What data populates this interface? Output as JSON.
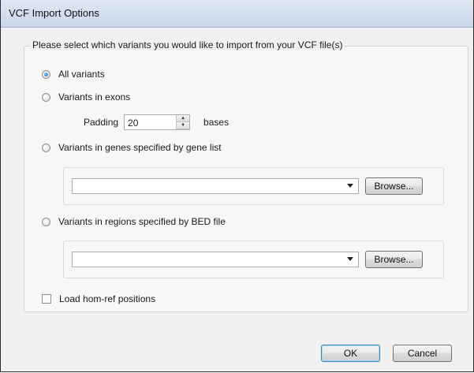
{
  "window": {
    "title": "VCF Import Options"
  },
  "group": {
    "label": "Please select which variants you would like to import from your VCF file(s)"
  },
  "options": {
    "all_variants": {
      "label": "All variants",
      "checked": true
    },
    "exons": {
      "label": "Variants in exons",
      "checked": false
    },
    "gene_list": {
      "label": "Variants in genes specified by gene list",
      "checked": false
    },
    "bed_file": {
      "label": "Variants in regions specified by BED file",
      "checked": false
    }
  },
  "padding": {
    "label": "Padding",
    "value": "20",
    "unit": "bases"
  },
  "gene_list_panel": {
    "combo_value": "",
    "browse_label": "Browse..."
  },
  "bed_panel": {
    "combo_value": "",
    "browse_label": "Browse..."
  },
  "homref": {
    "label": "Load hom-ref positions",
    "checked": false
  },
  "buttons": {
    "ok": "OK",
    "cancel": "Cancel"
  }
}
